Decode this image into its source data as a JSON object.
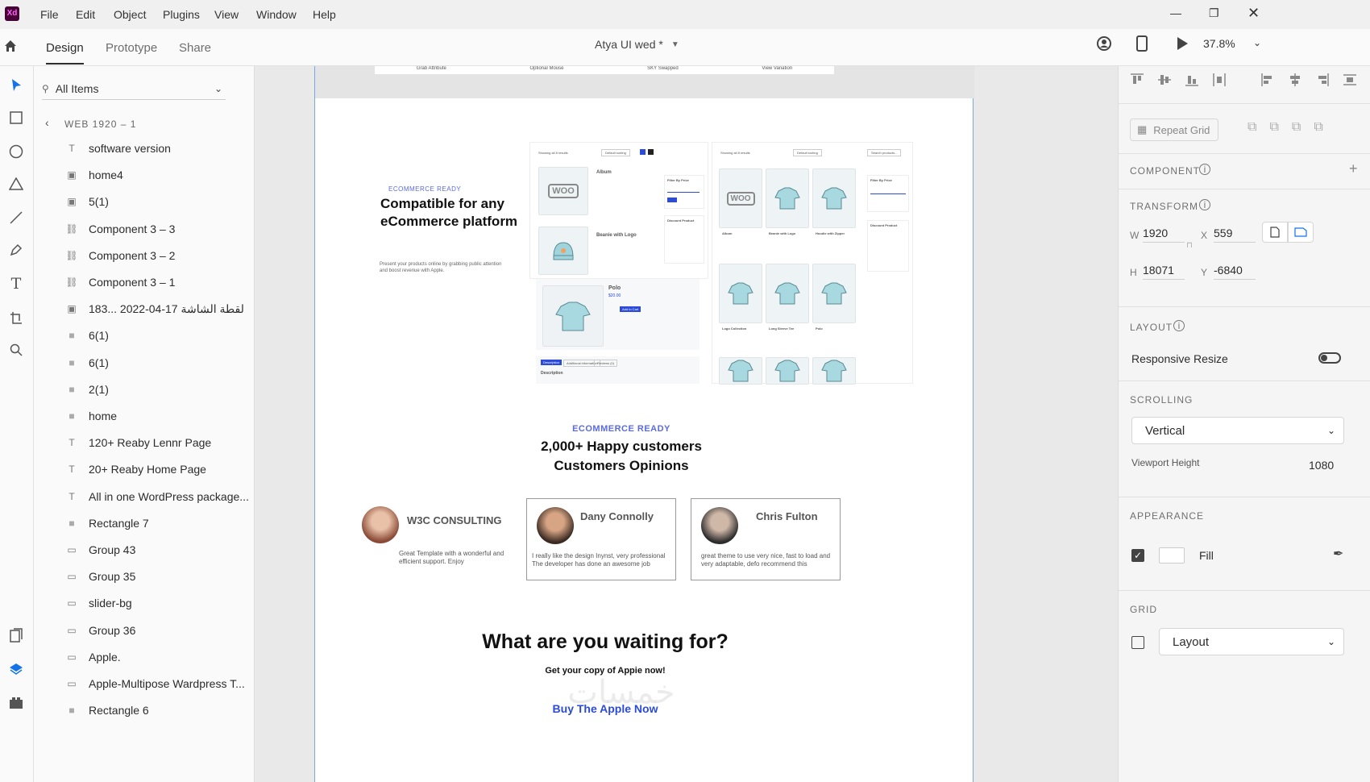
{
  "app": {
    "logo": "Xd",
    "file_title": "Atya UI wed *",
    "zoom": "37.8%"
  },
  "menu": [
    "File",
    "Edit",
    "Object",
    "Plugins",
    "View",
    "Window",
    "Help"
  ],
  "tabs": [
    "Design",
    "Prototype",
    "Share"
  ],
  "layers": {
    "search_placeholder": "All Items",
    "breadcrumb": "WEB 1920 – 1",
    "items": [
      {
        "label": "software version",
        "type": "text"
      },
      {
        "label": "home4",
        "type": "image"
      },
      {
        "label": "5(1)",
        "type": "image"
      },
      {
        "label": "Component 3 – 3",
        "type": "link"
      },
      {
        "label": "Component 3 – 2",
        "type": "link"
      },
      {
        "label": "Component 3 – 1",
        "type": "link"
      },
      {
        "label": "183... لقطة الشاشة 17-04-2022",
        "type": "image"
      },
      {
        "label": "6(1)",
        "type": "rect"
      },
      {
        "label": "6(1)",
        "type": "rect"
      },
      {
        "label": "2(1)",
        "type": "rect"
      },
      {
        "label": "home",
        "type": "rect"
      },
      {
        "label": "120+ Reaby Lennr Page",
        "type": "text"
      },
      {
        "label": "20+ Reaby Home Page",
        "type": "text"
      },
      {
        "label": "All in one WordPress package...",
        "type": "text"
      },
      {
        "label": "Rectangle 7",
        "type": "rect"
      },
      {
        "label": "Group 43",
        "type": "group"
      },
      {
        "label": "Group 35",
        "type": "group"
      },
      {
        "label": "slider-bg",
        "type": "group"
      },
      {
        "label": "Group 36",
        "type": "group"
      },
      {
        "label": "Apple.",
        "type": "group"
      },
      {
        "label": "Apple-Multipose Wardpress T...",
        "type": "group"
      },
      {
        "label": "Rectangle 6",
        "type": "rect"
      }
    ]
  },
  "artboard": {
    "top_tabs": [
      "Grab Attribute",
      "Optional Mouse",
      "SKY Swapped",
      "View Variation"
    ],
    "ecom_badge": "ECOMMERCE READY",
    "ecom_title": "Compatible for any eCommerce platform",
    "ecom_desc": "Present your products online by grabbing public attention and boost revenue with Apple.",
    "shop": {
      "sorting_label": "Showing all 8 results",
      "sort_default": "Default sorting",
      "search": "Search products...",
      "filter": "Filter By Price",
      "discount": "Discount Product",
      "prod_album": "Album",
      "prod_beanie": "Beanie with Logo",
      "prod_polo": "Polo",
      "polo_price": "$20.00",
      "add_to_cart": "Add to Cart",
      "desc_tab": "Description",
      "addl_tab": "Additional information",
      "reviews_tab": "Reviews (0)",
      "desc_heading": "Description",
      "grid_names": [
        "Album",
        "Beanie with Logo",
        "Hoodie with Zipper",
        "Logo Collection",
        "Long Sleeve Tee",
        "Polo"
      ],
      "sale": "Sale",
      "woo": "WOO"
    },
    "customers_badge": "ECOMMERCE READY",
    "customers_title1": "2,000+ Happy customers",
    "customers_title2": "Customers Opinions",
    "testimonials": [
      {
        "name": "W3C CONSULTING",
        "text": "Great Template with a wonderful and efficient support. Enjoy"
      },
      {
        "name": "Dany Connolly",
        "text": "I really like the design Inynst, very professional The developer has done an awesome job"
      },
      {
        "name": "Chris Fulton",
        "text": "great theme to use very nice, fast to load and very adaptable, defo recommend this"
      }
    ],
    "cta_title": "What are you waiting for?",
    "cta_sub": "Get your copy of Appie now!",
    "cta_link": "Buy The Apple Now",
    "watermark": "خمسات"
  },
  "props": {
    "repeat_grid": "Repeat Grid",
    "component": "COMPONENT",
    "transform": "TRANSFORM",
    "w_label": "W",
    "w": "1920",
    "x_label": "X",
    "x": "559",
    "h_label": "H",
    "h": "18071",
    "y_label": "Y",
    "y": "-6840",
    "layout": "LAYOUT",
    "responsive": "Responsive Resize",
    "responsive_on": false,
    "scrolling": "SCROLLING",
    "scroll_value": "Vertical",
    "viewport_label": "Viewport Height",
    "viewport": "1080",
    "appearance": "APPEARANCE",
    "fill": "Fill",
    "fill_checked": true,
    "grid": "GRID",
    "grid_value": "Layout",
    "grid_checked": false
  },
  "colors": {
    "accent": "#1473e6",
    "brand_blue": "#2b4bd8",
    "badge": "#5a6be0",
    "xd": "#470137"
  }
}
